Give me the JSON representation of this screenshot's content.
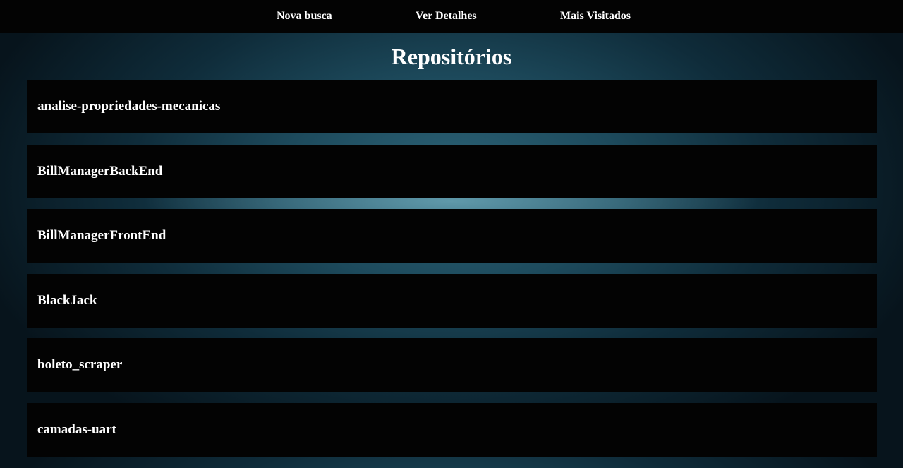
{
  "nav": {
    "items": [
      {
        "label": "Nova busca"
      },
      {
        "label": "Ver Detalhes"
      },
      {
        "label": "Mais Visitados"
      }
    ]
  },
  "main": {
    "title": "Repositórios",
    "repositories": [
      {
        "name": "analise-propriedades-mecanicas"
      },
      {
        "name": "BillManagerBackEnd"
      },
      {
        "name": "BillManagerFrontEnd"
      },
      {
        "name": "BlackJack"
      },
      {
        "name": "boleto_scraper"
      },
      {
        "name": "camadas-uart"
      }
    ]
  },
  "colors": {
    "nav_background": "#030303",
    "card_background": "#030303",
    "text": "#ffffff",
    "page_background": "#1d4a5c"
  }
}
